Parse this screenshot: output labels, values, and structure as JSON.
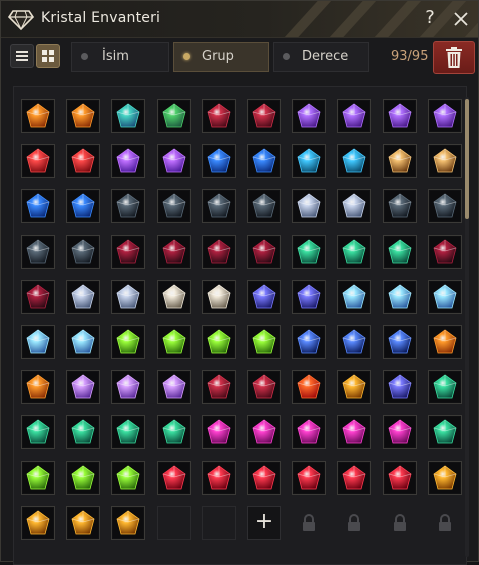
{
  "window": {
    "title": "Kristal Envanteri",
    "help_glyph": "?",
    "title_icon": "diamond-icon",
    "close_icon": "close-icon"
  },
  "toolbar": {
    "list_view_icon": "list-icon",
    "grid_view_icon": "grid-icon",
    "sort_tabs": [
      {
        "label": "İsim",
        "active": false
      },
      {
        "label": "Grup",
        "active": true
      },
      {
        "label": "Derece",
        "active": false
      }
    ],
    "count": "93/95",
    "trash_icon": "trash-icon"
  },
  "colors": {
    "accent": "#c9a964",
    "count_text": "#c9a27a",
    "trash_bg": "#7a221d"
  },
  "grid": {
    "columns": 10,
    "add_slot_glyph": "+",
    "rows": [
      [
        "orange",
        "orange",
        "teal",
        "green",
        "crimson",
        "crimson",
        "violet",
        "violet",
        "violet",
        "violet"
      ],
      [
        "red",
        "red",
        "purple",
        "purple",
        "blue",
        "blue",
        "cyan",
        "cyan",
        "gold",
        "gold"
      ],
      [
        "blue",
        "blue",
        "dark",
        "dark",
        "dark",
        "dark",
        "silver",
        "silver",
        "dark",
        "dark"
      ],
      [
        "dark",
        "dark",
        "garnet",
        "garnet",
        "garnet",
        "garnet",
        "emerald",
        "emerald",
        "emerald",
        "garnet"
      ],
      [
        "garnet",
        "silver",
        "silver",
        "white",
        "white",
        "indigo",
        "indigo",
        "ice",
        "ice",
        "ice"
      ],
      [
        "ice",
        "ice",
        "lime",
        "lime",
        "lime",
        "lime",
        "navy",
        "navy",
        "navy",
        "orange"
      ],
      [
        "orange",
        "lavender",
        "lavender",
        "lavender",
        "crimson",
        "crimson",
        "sunred",
        "amber",
        "indigo",
        "emerald"
      ],
      [
        "emerald",
        "emerald",
        "emerald",
        "emerald",
        "magenta",
        "magenta",
        "magenta",
        "magenta",
        "magenta",
        "emerald"
      ],
      [
        "lime",
        "lime",
        "lime",
        "ruby",
        "ruby",
        "ruby",
        "ruby",
        "ruby",
        "ruby",
        "amber"
      ],
      [
        "amber",
        "amber",
        "amber",
        "empty",
        "empty",
        "add",
        "locked",
        "locked",
        "locked",
        "locked"
      ]
    ]
  }
}
